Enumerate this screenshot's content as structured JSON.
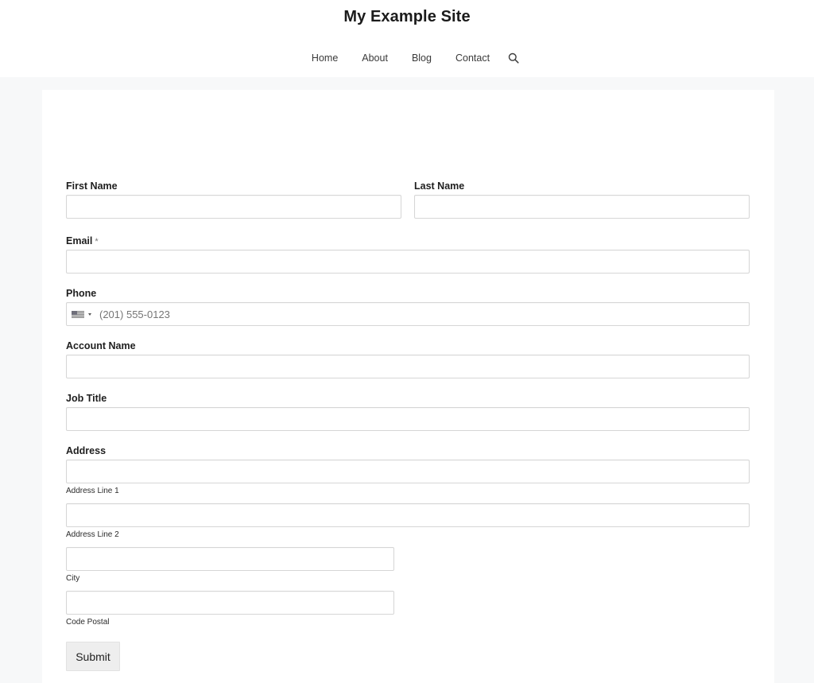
{
  "site": {
    "title": "My Example Site"
  },
  "nav": {
    "items": [
      {
        "label": "Home"
      },
      {
        "label": "About"
      },
      {
        "label": "Blog"
      },
      {
        "label": "Contact"
      }
    ],
    "search_icon": "search-icon"
  },
  "form": {
    "first_name": {
      "label": "First Name",
      "value": "",
      "placeholder": ""
    },
    "last_name": {
      "label": "Last Name",
      "value": "",
      "placeholder": ""
    },
    "email": {
      "label": "Email",
      "required_marker": "*",
      "value": "",
      "placeholder": ""
    },
    "phone": {
      "label": "Phone",
      "country_flag_icon": "us-flag-icon",
      "value": "",
      "placeholder": "(201) 555-0123"
    },
    "account_name": {
      "label": "Account Name",
      "value": "",
      "placeholder": ""
    },
    "job_title": {
      "label": "Job Title",
      "value": "",
      "placeholder": ""
    },
    "address": {
      "label": "Address",
      "line1": {
        "sublabel": "Address Line 1",
        "value": ""
      },
      "line2": {
        "sublabel": "Address Line 2",
        "value": ""
      },
      "city": {
        "sublabel": "City",
        "value": ""
      },
      "postal": {
        "sublabel": "Code Postal",
        "value": ""
      }
    },
    "submit_label": "Submit"
  }
}
